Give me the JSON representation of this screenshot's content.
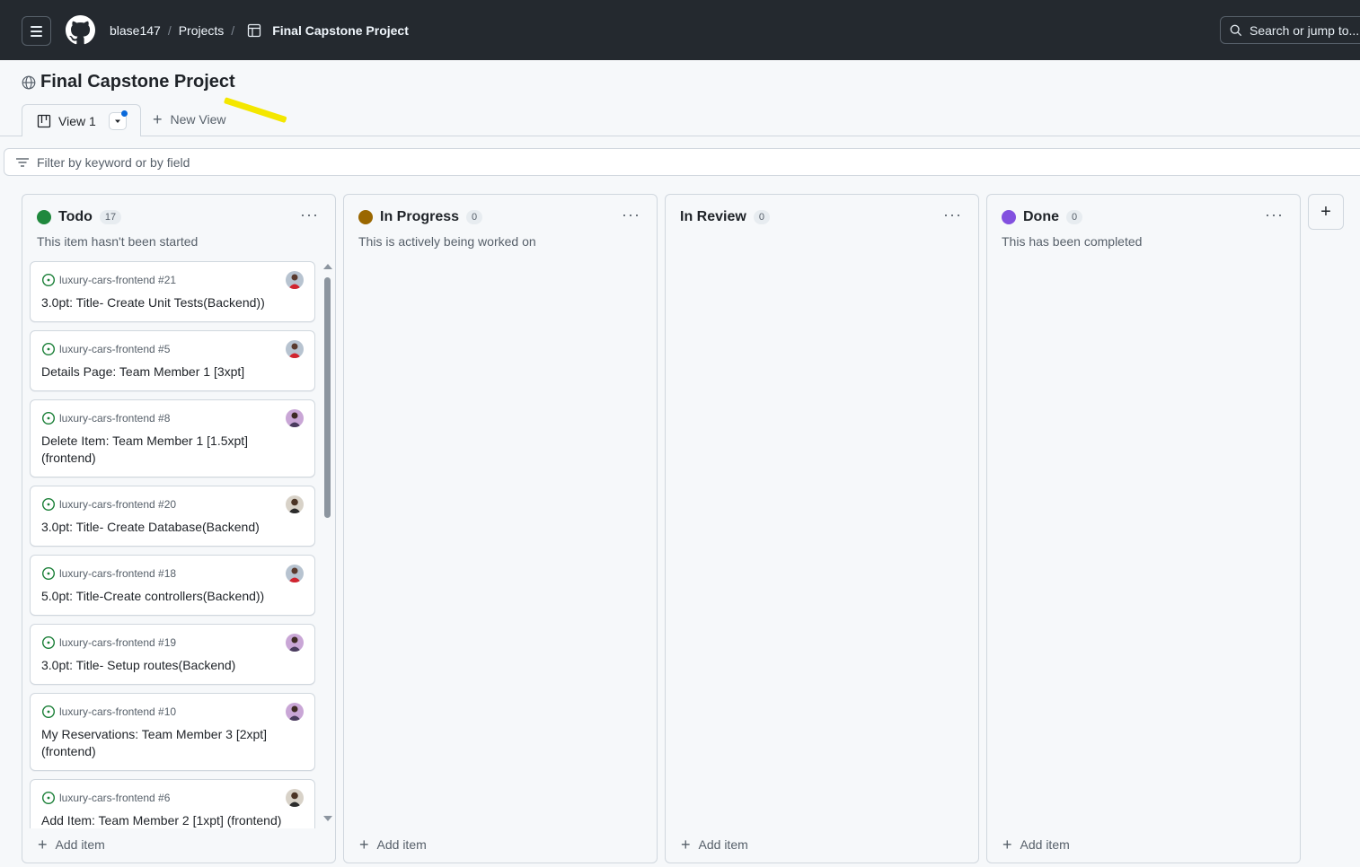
{
  "header": {
    "breadcrumbs": [
      "blase147",
      "Projects",
      "Final Capstone Project"
    ],
    "search_placeholder": "Search or jump to..."
  },
  "project": {
    "title": "Final Capstone Project"
  },
  "views": {
    "active_tab": "View 1",
    "new_view": "New View"
  },
  "filter": {
    "placeholder": "Filter by keyword or by field"
  },
  "columns": [
    {
      "name": "Todo",
      "count": "17",
      "color": "#1f883d",
      "description": "This item hasn't been started",
      "add_item": "Add item",
      "cards": [
        {
          "repo": "luxury-cars-frontend #21",
          "title": "3.0pt: Title- Create Unit Tests(Backend))",
          "avatar": "red"
        },
        {
          "repo": "luxury-cars-frontend #5",
          "title": "Details Page: Team Member 1 [3xpt]",
          "avatar": "red"
        },
        {
          "repo": "luxury-cars-frontend #8",
          "title": "Delete Item: Team Member 1 [1.5xpt] (frontend)",
          "avatar": "purple"
        },
        {
          "repo": "luxury-cars-frontend #20",
          "title": "3.0pt: Title- Create Database(Backend)",
          "avatar": "dark"
        },
        {
          "repo": "luxury-cars-frontend #18",
          "title": "5.0pt: Title-Create controllers(Backend))",
          "avatar": "red"
        },
        {
          "repo": "luxury-cars-frontend #19",
          "title": "3.0pt: Title- Setup routes(Backend)",
          "avatar": "purple"
        },
        {
          "repo": "luxury-cars-frontend #10",
          "title": "My Reservations: Team Member 3 [2xpt] (frontend)",
          "avatar": "purple"
        },
        {
          "repo": "luxury-cars-frontend #6",
          "title": "Add Item: Team Member 2 [1xpt] (frontend)",
          "avatar": "dark"
        }
      ]
    },
    {
      "name": "In Progress",
      "count": "0",
      "color": "#9a6700",
      "description": "This is actively being worked on",
      "add_item": "Add item",
      "cards": []
    },
    {
      "name": "In Review",
      "count": "0",
      "color": "",
      "description": "",
      "add_item": "Add item",
      "cards": []
    },
    {
      "name": "Done",
      "count": "0",
      "color": "#8250df",
      "description": "This has been completed",
      "add_item": "Add item",
      "cards": []
    }
  ]
}
